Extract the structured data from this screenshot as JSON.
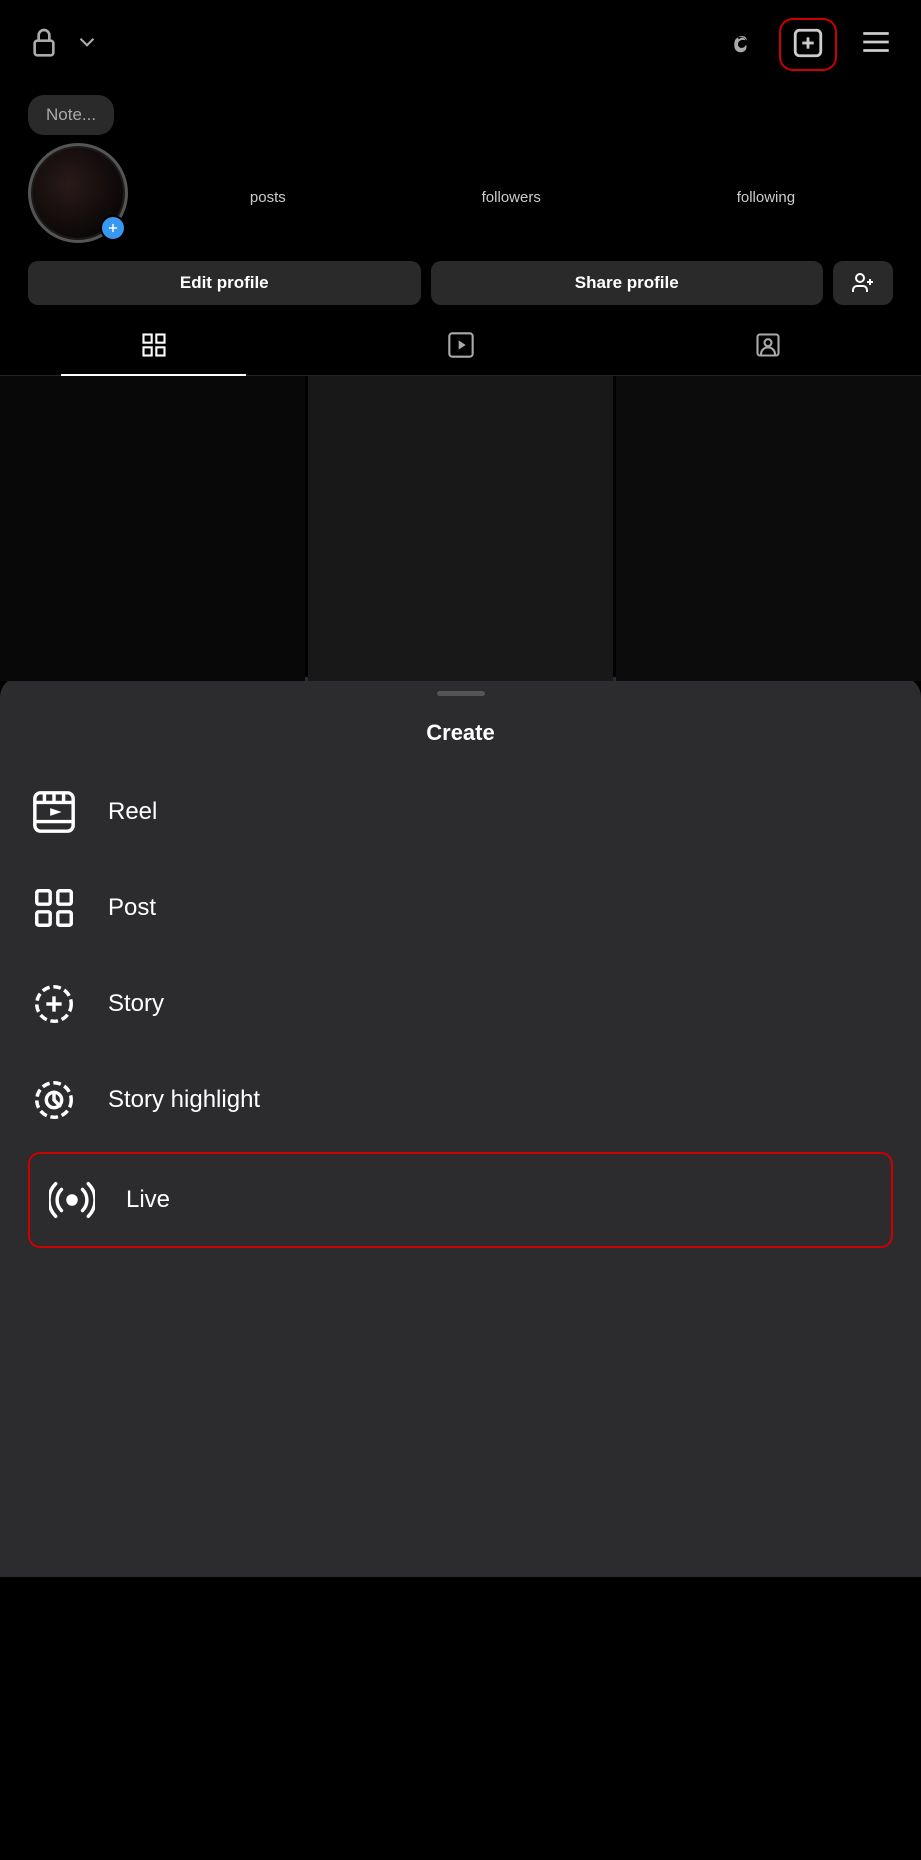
{
  "topbar": {
    "lock_label": "lock",
    "chevron_label": "dropdown",
    "threads_label": "threads",
    "create_label": "create-new",
    "menu_label": "menu"
  },
  "profile": {
    "note_placeholder": "Note...",
    "stats": [
      {
        "value": "",
        "label": "posts"
      },
      {
        "value": "",
        "label": "followers"
      },
      {
        "value": "",
        "label": "following"
      }
    ],
    "edit_button": "Edit profile",
    "share_button": "Share profile"
  },
  "tabs": [
    {
      "name": "grid-tab",
      "label": "Grid",
      "active": true
    },
    {
      "name": "reels-tab",
      "label": "Reels",
      "active": false
    },
    {
      "name": "tagged-tab",
      "label": "Tagged",
      "active": false
    }
  ],
  "create_sheet": {
    "title": "Create",
    "items": [
      {
        "id": "reel",
        "label": "Reel",
        "highlighted": false
      },
      {
        "id": "post",
        "label": "Post",
        "highlighted": false
      },
      {
        "id": "story",
        "label": "Story",
        "highlighted": false
      },
      {
        "id": "story-highlight",
        "label": "Story highlight",
        "highlighted": false
      },
      {
        "id": "live",
        "label": "Live",
        "highlighted": true
      }
    ]
  },
  "colors": {
    "highlight_border": "#cc0000",
    "accent_blue": "#3897f0",
    "bg_dark": "#000000",
    "bg_sheet": "#2c2c2e"
  }
}
